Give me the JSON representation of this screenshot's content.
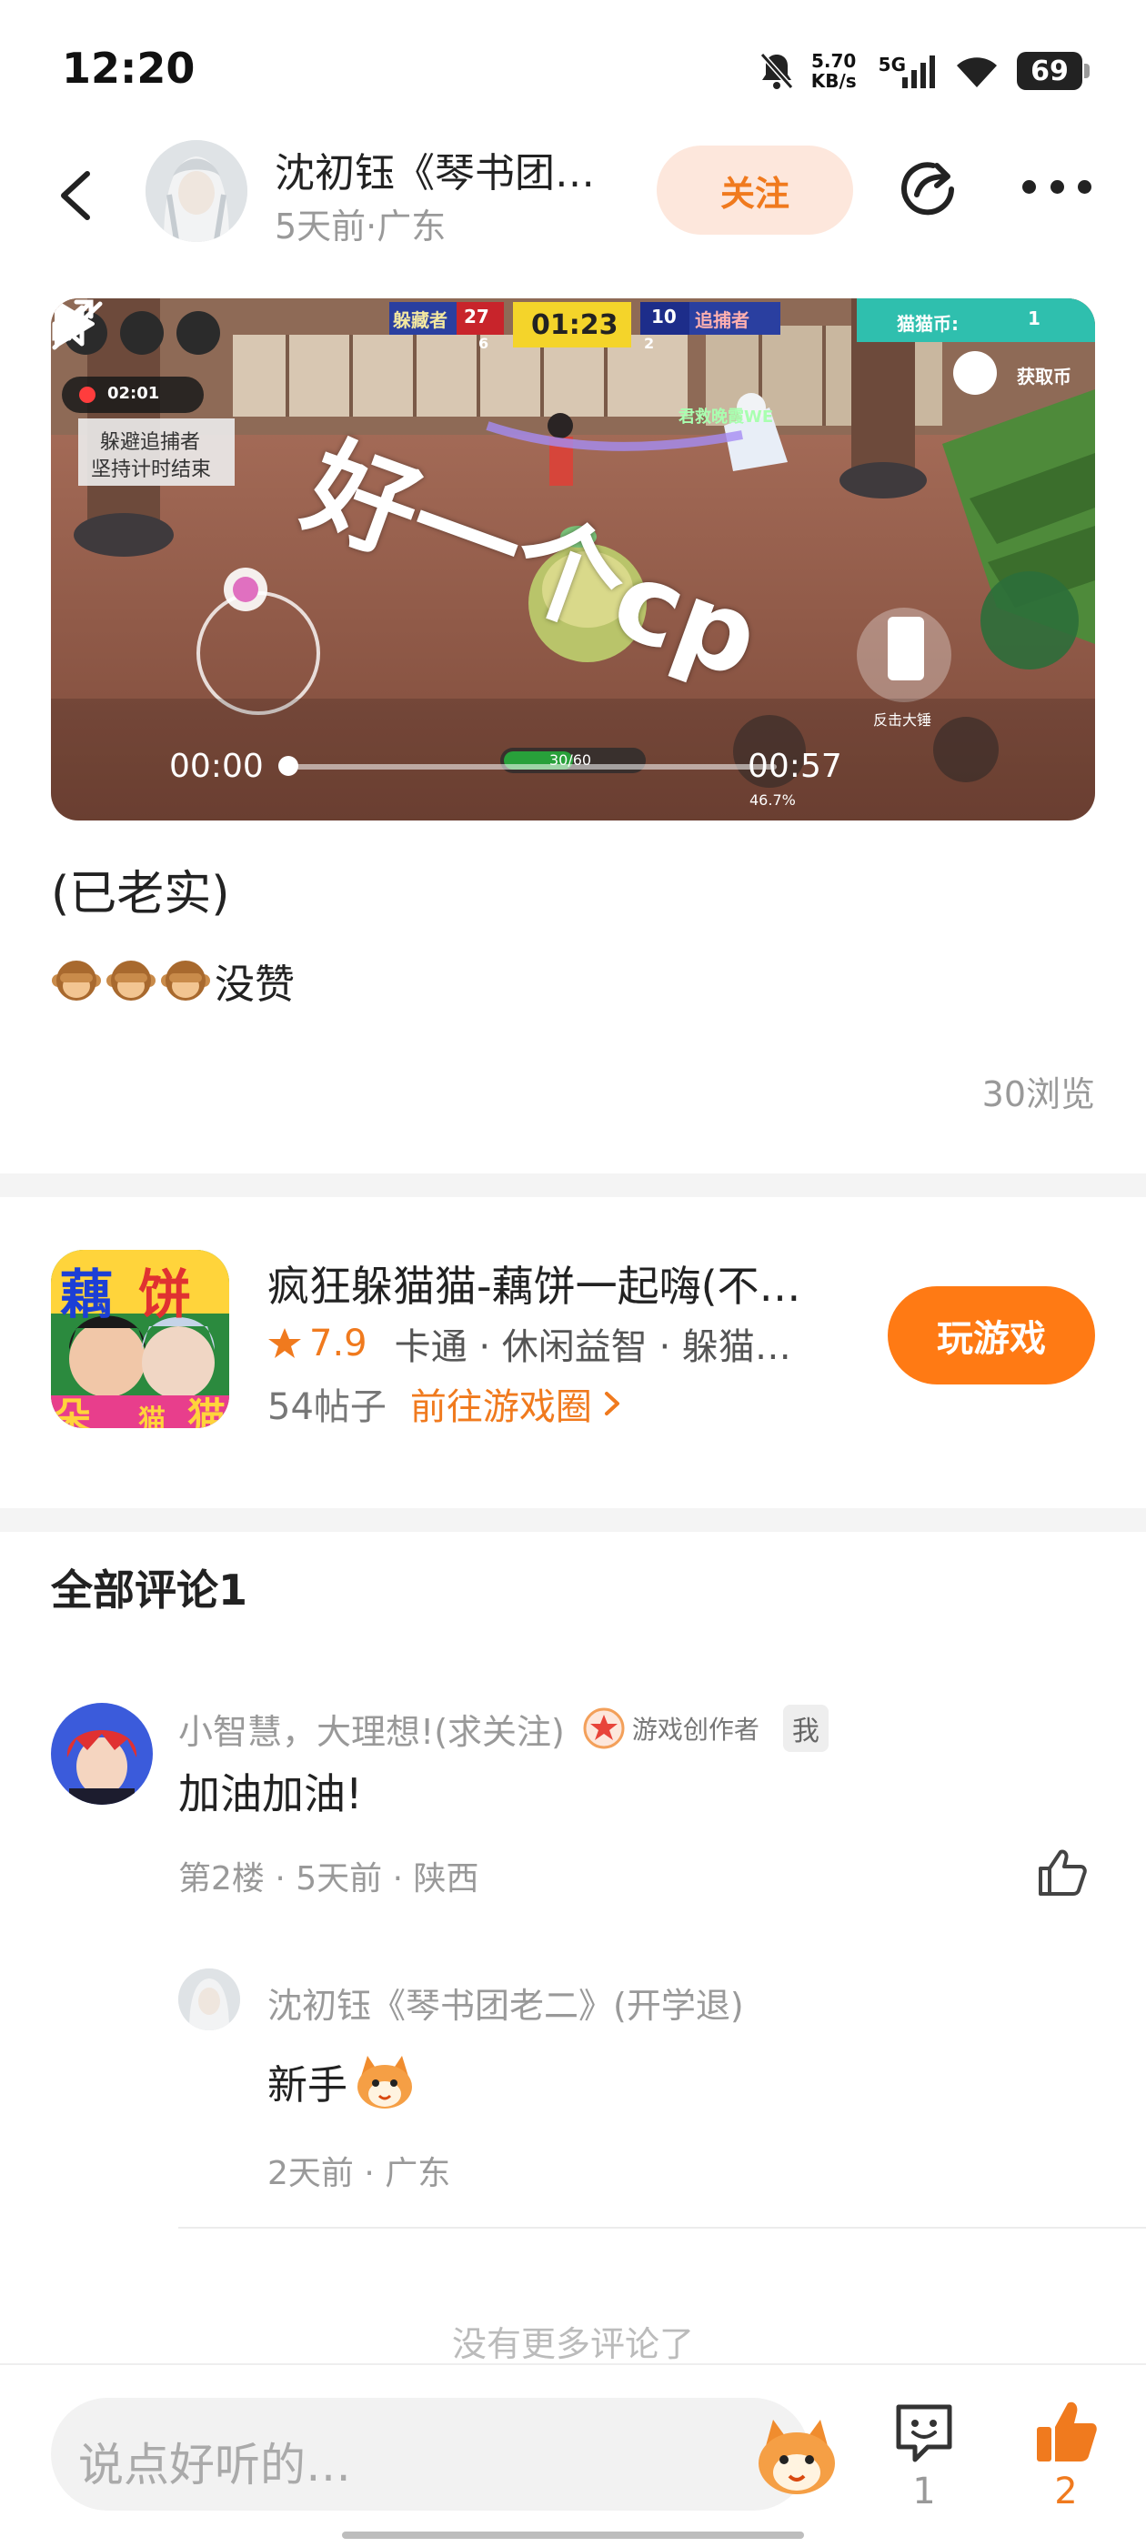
{
  "status_bar": {
    "time": "12:20",
    "net_speed_value": "5.70",
    "net_speed_unit": "KB/s",
    "network": "5G",
    "battery": "69"
  },
  "header": {
    "author_name": "沈初钰《琴书团…",
    "author_meta": "5天前·广东",
    "follow_label": "关注"
  },
  "video": {
    "overlay_text": "好一个cp",
    "time_current": "00:00",
    "time_total": "00:57",
    "progress": 0.0,
    "hud": {
      "team_left": "躲藏者",
      "score_left": "27",
      "count_left": "6",
      "timer": "01:23",
      "score_right": "10",
      "count_right": "2",
      "team_right": "追捕者",
      "coin_label": "猫猫币:",
      "coin_value": "1",
      "reward_label": "获取币",
      "rec_time": "02:01",
      "task_line1": "躲避追捕者",
      "task_line2": "坚持计时结束",
      "player_name": "君救晚霞WE",
      "hp": "30/60",
      "percent": "46.7%",
      "hammer_label": "反击大锤"
    }
  },
  "post": {
    "title": "(已老实)",
    "body_text": "没赞",
    "emoji_count": 3,
    "views": "30浏览"
  },
  "game": {
    "icon_text_1": "藕",
    "icon_text_2": "饼",
    "icon_text_3": "朵",
    "icon_text_4": "猫",
    "icon_text_5": "猫",
    "name": "疯狂躲猫猫-藕饼一起嗨(不…",
    "rating": "7.9",
    "tags": "卡通 · 休闲益智 · 躲猫…",
    "posts": "54帖子",
    "goto_label": "前往游戏圈",
    "play_label": "玩游戏"
  },
  "comments": {
    "title": "全部评论1",
    "items": [
      {
        "name": "小智慧，大理想!(求关注)",
        "creator_label": "游戏创作者",
        "badge": "我",
        "text": "加油加油!",
        "meta": "第2楼 · 5天前 · 陕西",
        "replies": [
          {
            "name": "沈初钰《琴书团老二》(开学退)",
            "text": "新手",
            "meta": "2天前 · 广东"
          }
        ]
      }
    ],
    "no_more": "没有更多评论了"
  },
  "bottom_bar": {
    "input_placeholder": "说点好听的…",
    "comment_count": "1",
    "like_count": "2"
  },
  "colors": {
    "accent": "#f07a1e",
    "follow_bg": "#fde7dc",
    "play_button": "#ff7a14"
  }
}
